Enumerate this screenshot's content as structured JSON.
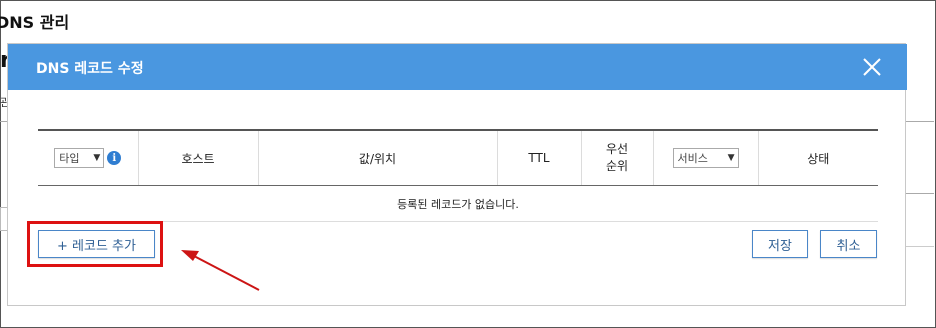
{
  "background": {
    "page_title": "DNS 관리",
    "fragment_large": "r",
    "fragment_small": "관"
  },
  "modal": {
    "title": "DNS 레코드 수정",
    "table": {
      "columns": {
        "type_select": "타입",
        "host": "호스트",
        "value": "값/위치",
        "ttl": "TTL",
        "priority": "우선 순위",
        "service_select": "서비스",
        "status": "상태"
      },
      "empty_message": "등록된 레코드가 없습니다."
    },
    "buttons": {
      "add_record": "+ 레코드 추가",
      "save": "저장",
      "cancel": "취소"
    }
  },
  "colors": {
    "header_blue": "#4a97e0",
    "annotation_red": "#dd1111"
  }
}
